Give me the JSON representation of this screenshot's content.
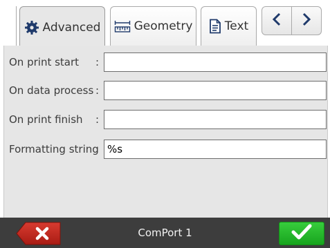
{
  "tabs": [
    {
      "label": "Advanced",
      "icon": "gear-icon",
      "active": true
    },
    {
      "label": "Geometry",
      "icon": "ruler-icon",
      "active": false
    },
    {
      "label": "Text",
      "icon": "document-icon",
      "active": false
    }
  ],
  "nav": {
    "prev_icon": "chevron-left-icon",
    "next_icon": "chevron-right-icon"
  },
  "fields": [
    {
      "label": "On print start",
      "colon": ":",
      "value": ""
    },
    {
      "label": "On data process",
      "colon": ":",
      "value": ""
    },
    {
      "label": "On print finish",
      "colon": ":",
      "value": ""
    },
    {
      "label": "Formatting string",
      "colon": ":",
      "value": "%s"
    }
  ],
  "footer": {
    "status": "ComPort 1",
    "cancel_icon": "close-icon",
    "ok_icon": "checkmark-icon"
  },
  "colors": {
    "cancel": "#c42a20",
    "ok": "#22b327",
    "accent_icon": "#1f3a6b"
  }
}
